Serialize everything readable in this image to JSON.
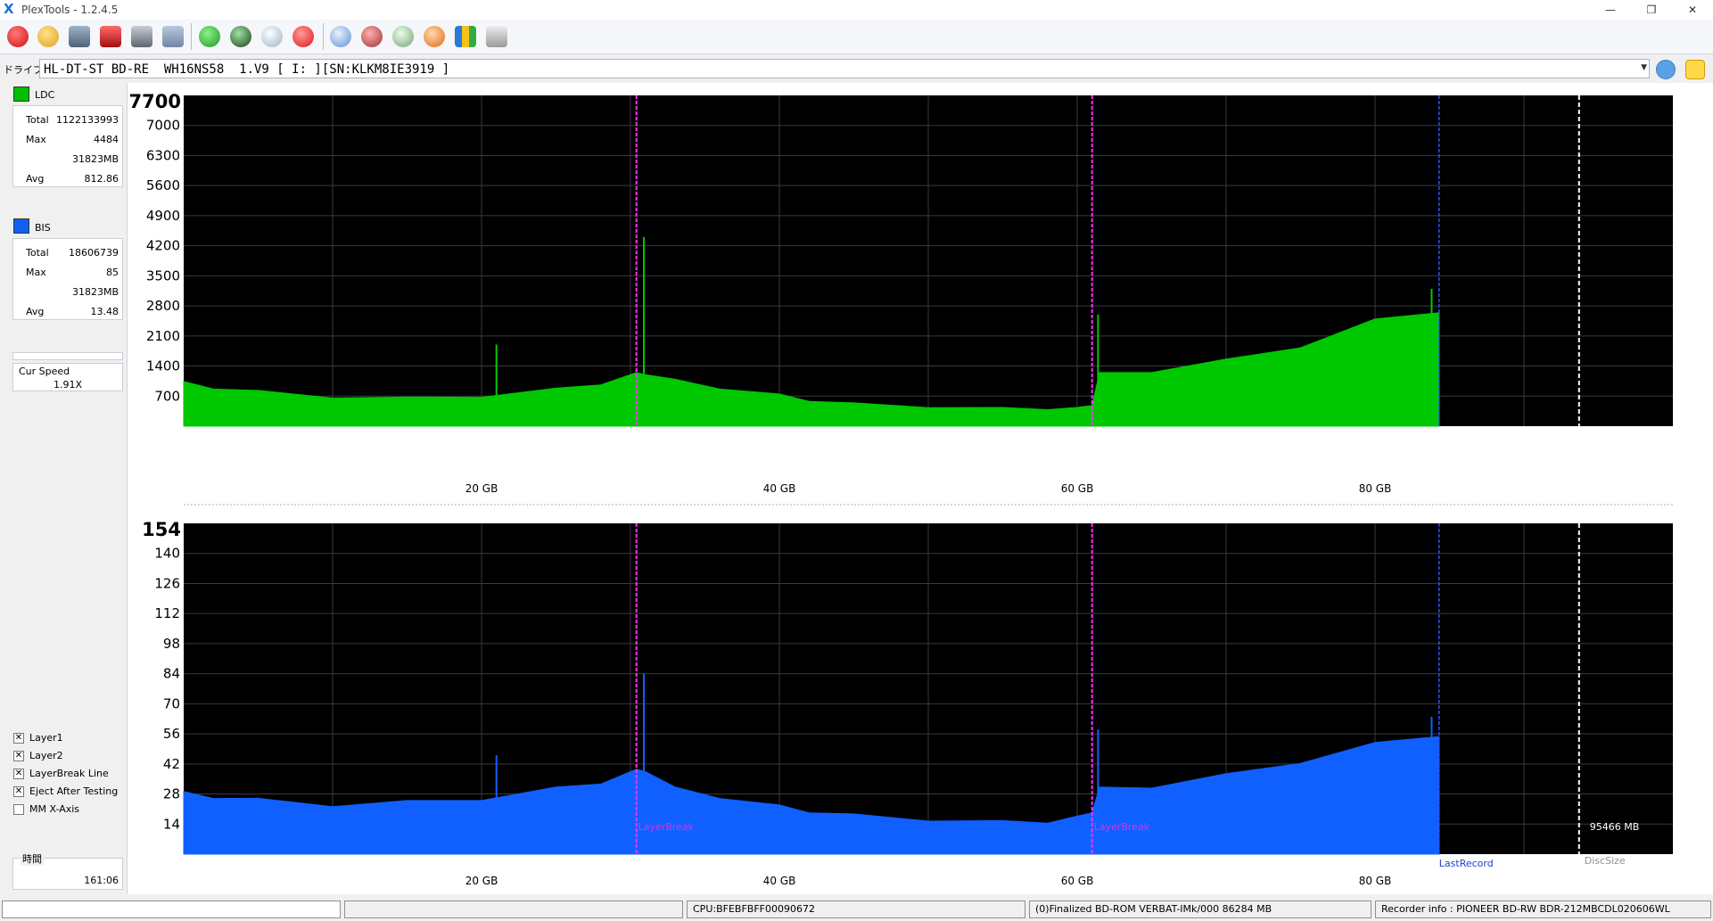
{
  "window": {
    "title": "PlexTools - 1.2.4.5",
    "minimize": "—",
    "restore": "❐",
    "close": "✕"
  },
  "drive": {
    "label": "ドライブ",
    "value": "HL-DT-ST BD-RE  WH16NS58  1.V9 [ I: ][SN:KLKM8IE3919 ]"
  },
  "ldc": {
    "label": "LDC",
    "color": "#00c000",
    "total_label": "Total",
    "total": "1122133993",
    "max_label": "Max",
    "max": "4484",
    "size": "31823MB",
    "avg_label": "Avg",
    "avg": "812.86"
  },
  "bis": {
    "label": "BIS",
    "color": "#1060f0",
    "total_label": "Total",
    "total": "18606739",
    "max_label": "Max",
    "max": "85",
    "size": "31823MB",
    "avg_label": "Avg",
    "avg": "13.48"
  },
  "speed": {
    "label": "Cur Speed",
    "value": "1.91X"
  },
  "options": [
    {
      "label": "Layer1",
      "checked": "✕"
    },
    {
      "label": "Layer2",
      "checked": "✕"
    },
    {
      "label": "LayerBreak Line",
      "checked": "✕"
    },
    {
      "label": "Eject After Testing",
      "checked": "✕"
    },
    {
      "label": "MM X-Axis",
      "checked": ""
    }
  ],
  "time": {
    "label": "時間",
    "value": "161:06"
  },
  "status": {
    "cpu": "CPU:BFEBFBFF00090672",
    "disc": "(0)Finalized   BD-ROM   VERBAT-IMk/000   86284 MB",
    "recorder": "Recorder info : PIONEER       BD-RW   BDR-212MBCDL020606WL"
  },
  "chart_data": [
    {
      "type": "area",
      "name": "LDC",
      "color": "#00c800",
      "x_ticks": [
        20,
        40,
        60,
        80
      ],
      "x_tick_labels": [
        "20 GB",
        "40 GB",
        "60 GB",
        "80 GB"
      ],
      "xlim": [
        0,
        100
      ],
      "y_ticks": [
        700,
        1400,
        2100,
        2800,
        3500,
        4200,
        4900,
        5600,
        6300,
        7000
      ],
      "y_max_label": "7700",
      "ylim": [
        0,
        7700
      ],
      "x": [
        0,
        2,
        5,
        10,
        15,
        20,
        25,
        28,
        30.4,
        31,
        33,
        36,
        40,
        42,
        45,
        50,
        55,
        58,
        60,
        61.0,
        61.5,
        65,
        70,
        75,
        80,
        84.3
      ],
      "y": [
        1000,
        900,
        800,
        680,
        650,
        700,
        850,
        1000,
        1200,
        1250,
        1050,
        900,
        720,
        600,
        520,
        450,
        420,
        400,
        420,
        500,
        1200,
        1300,
        1500,
        1900,
        2400,
        2750
      ],
      "spikes": [
        {
          "x": 21,
          "y": 1900
        },
        {
          "x": 30.9,
          "y": 4400
        },
        {
          "x": 61.4,
          "y": 2600
        },
        {
          "x": 83.8,
          "y": 3200
        }
      ],
      "layer_breaks": [
        30.4,
        61.0
      ],
      "last_record": 84.3,
      "disc_size": 93.7,
      "layerbreak_label": "LayerBreak",
      "last_record_label": "LastRecord",
      "disc_size_label": "DiscSize",
      "disc_size_value": "95466 MB"
    },
    {
      "type": "area",
      "name": "BIS",
      "color": "#1060ff",
      "x_ticks": [
        20,
        40,
        60,
        80
      ],
      "x_tick_labels": [
        "20 GB",
        "40 GB",
        "60 GB",
        "80 GB"
      ],
      "xlim": [
        0,
        100
      ],
      "y_ticks": [
        14,
        28,
        42,
        56,
        70,
        84,
        98,
        112,
        126,
        140
      ],
      "y_max_label": "154",
      "ylim": [
        0,
        154
      ],
      "x": [
        0,
        2,
        5,
        10,
        15,
        20,
        25,
        28,
        30.4,
        31,
        33,
        36,
        40,
        42,
        45,
        50,
        55,
        58,
        60,
        61.0,
        61.5,
        65,
        70,
        75,
        80,
        84.3
      ],
      "y": [
        28,
        27,
        25,
        23,
        24,
        26,
        30,
        34,
        38,
        40,
        30,
        27,
        22,
        20,
        18,
        16,
        15,
        15,
        17,
        20,
        30,
        32,
        36,
        44,
        50,
        57
      ],
      "spikes": [
        {
          "x": 30.9,
          "y": 84
        },
        {
          "x": 21,
          "y": 46
        },
        {
          "x": 61.4,
          "y": 58
        },
        {
          "x": 83.8,
          "y": 64
        }
      ],
      "layer_breaks": [
        30.4,
        61.0
      ],
      "last_record": 84.3,
      "disc_size": 93.7,
      "layerbreak_label": "LayerBreak",
      "last_record_label": "LastRecord",
      "disc_size_label": "DiscSize",
      "disc_size_value": "95466 MB"
    }
  ]
}
